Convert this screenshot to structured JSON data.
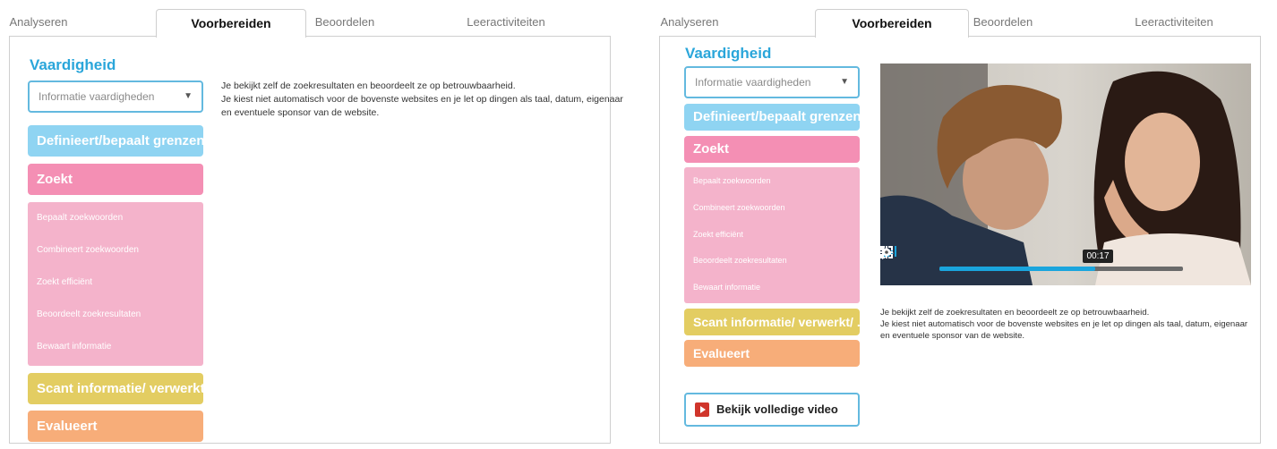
{
  "tabs": [
    "Analyseren",
    "Voorbereiden",
    "Beoordelen",
    "Leeractiviteiten"
  ],
  "active_tab": "Voorbereiden",
  "section_title": "Vaardigheid",
  "dropdown": {
    "left_value": "Informatie vaardigheden",
    "right_value": "Informatie vaardigheden"
  },
  "skills": {
    "definieert": "Definieert/bepaalt grenzen",
    "zoekt": "Zoekt",
    "scant": "Scant informatie/ verwerkt/ ...",
    "evalueert": "Evalueert"
  },
  "sub_items": [
    "Bepaalt zoekwoorden",
    "Combineert zoekwoorden",
    "Zoekt efficiënt",
    "Beoordeelt zoekresultaten",
    "Bewaart informatie"
  ],
  "description": {
    "left": [
      "Je bekijkt zelf de zoekresultaten en beoordeelt ze op betrouwbaarheid.",
      "Je kiest niet automatisch voor de bovenste websites en je let op dingen als taal, datum, eigenaar",
      "en eventuele sponsor van de website."
    ],
    "right": [
      "Je bekijkt zelf de zoekresultaten en beoordeelt ze op betrouwbaarheid.",
      "Je kiest niet automatisch voor de bovenste websites en je let op dingen als taal, datum, eigenaar",
      "en eventuele sponsor van de website."
    ]
  },
  "video": {
    "time": "00:17",
    "progress": 0.64
  },
  "watch_button": "Bekijk volledige video",
  "colors": {
    "accent": "#2aa6da",
    "blue_skill": "#8fd4f2",
    "pink_skill": "#f48fb4",
    "pink_sub": "#f4b3cb",
    "yellow_skill": "#e3cd62",
    "orange_skill": "#f7ad79",
    "progress": "#1aa5dd"
  },
  "icons": [
    "chevron-down-icon",
    "play-icon",
    "volume-icon",
    "gear-icon",
    "fullscreen-icon",
    "video-play-icon"
  ]
}
